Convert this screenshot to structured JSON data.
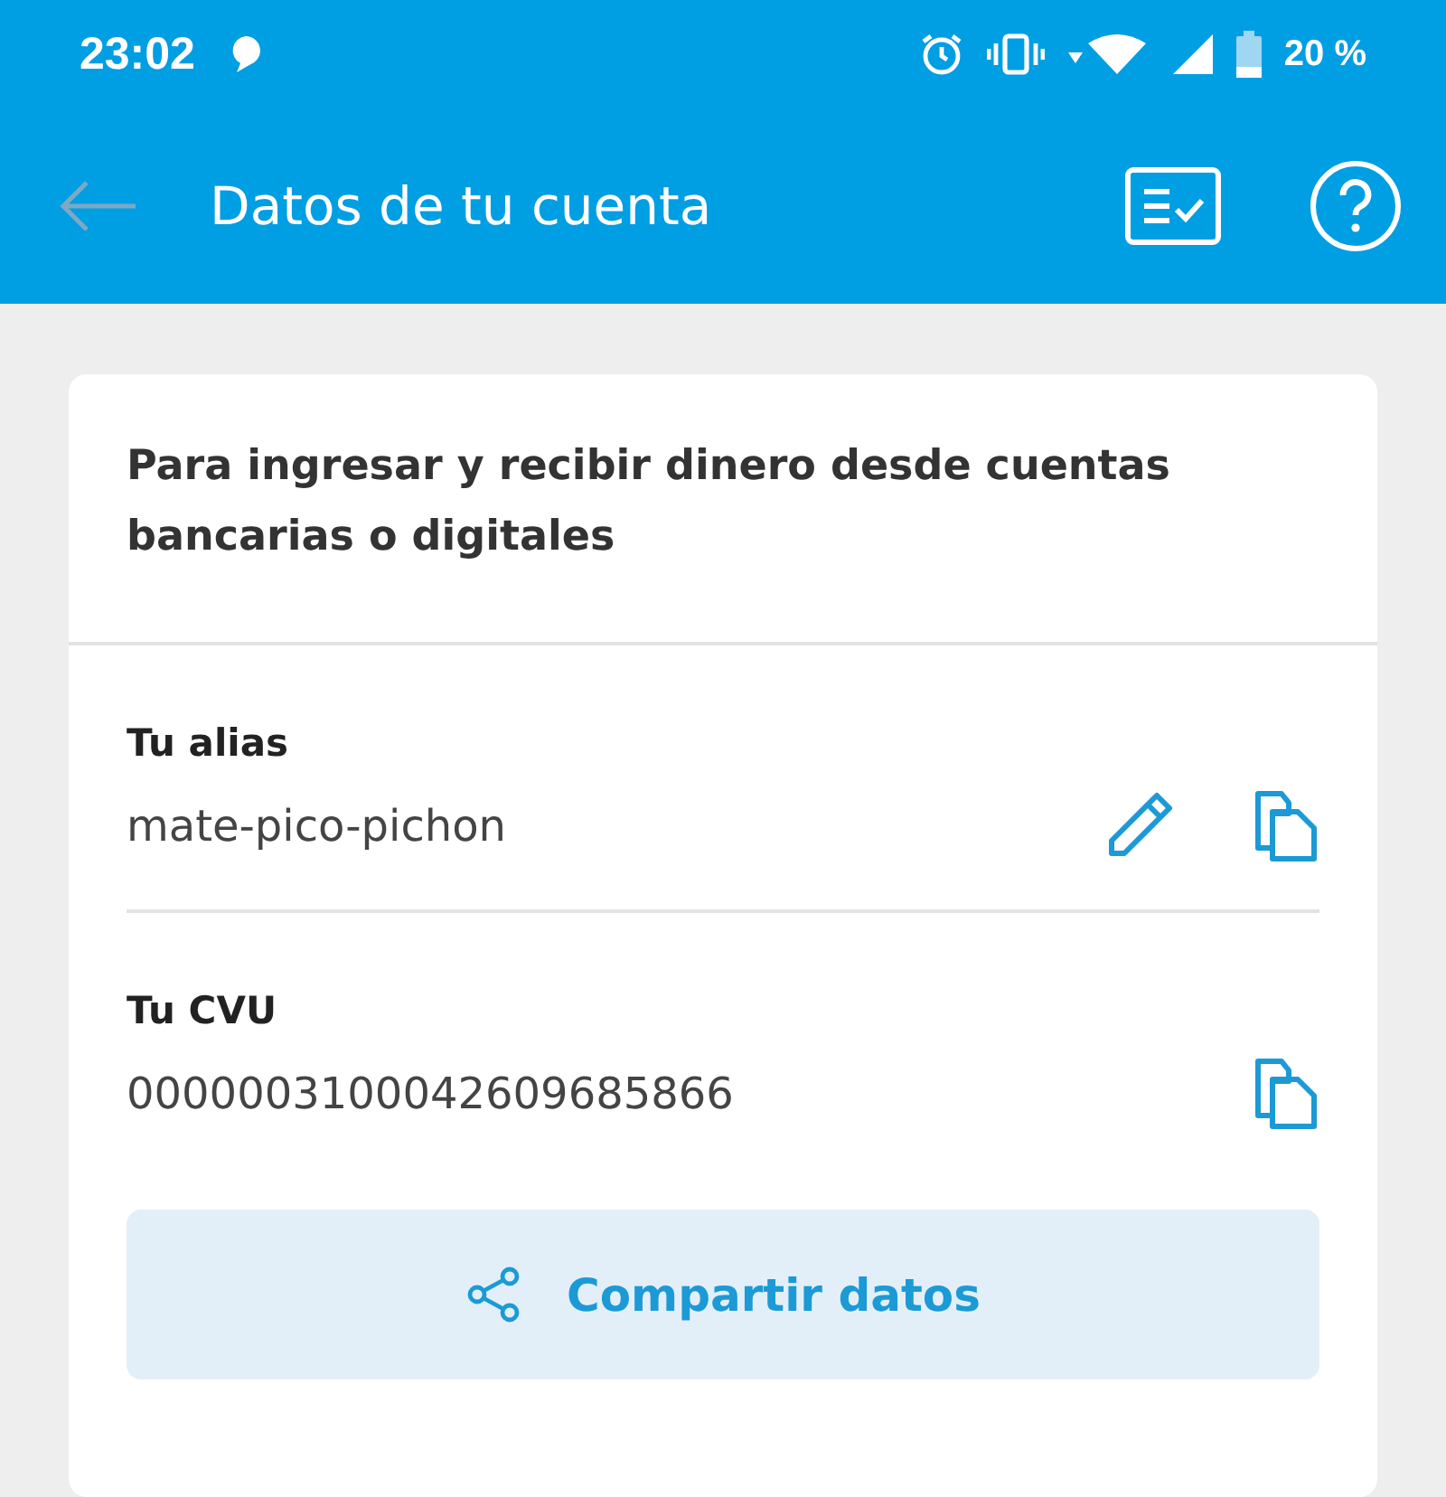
{
  "status_bar": {
    "time": "23:02",
    "battery_text": "20 %"
  },
  "app_bar": {
    "title": "Datos de tu cuenta"
  },
  "card": {
    "description": "Para ingresar y recibir dinero desde cuentas bancarias o digitales",
    "fields": [
      {
        "label": "Tu alias",
        "value": "mate-pico-pichon",
        "actions": [
          {
            "kind": "edit"
          },
          {
            "kind": "copy"
          }
        ]
      },
      {
        "label": "Tu CVU",
        "value": "0000003100042609685866",
        "actions": [
          {
            "kind": "copy"
          }
        ]
      }
    ],
    "share_button": {
      "label": "Compartir datos"
    }
  }
}
